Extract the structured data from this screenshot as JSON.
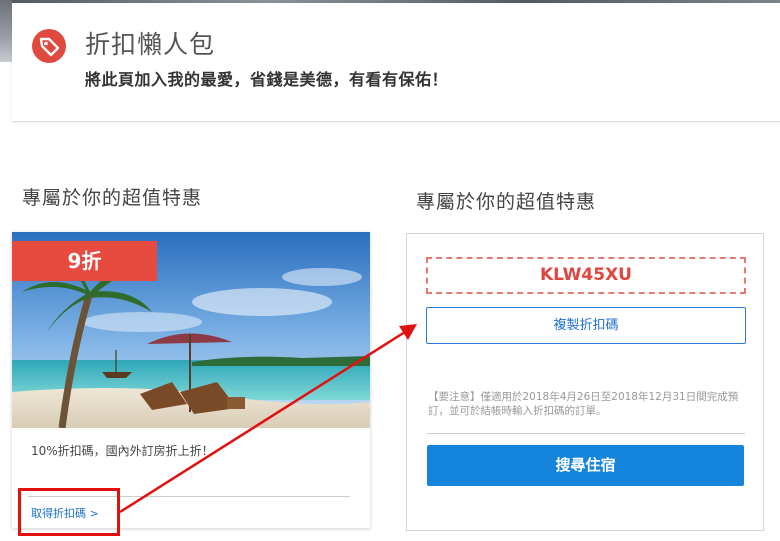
{
  "banner": {
    "icon": "tag-icon",
    "title": "折扣懶人包",
    "subtitle": "將此頁加入我的最愛，省錢是美德，有看有保佑！"
  },
  "left_section": {
    "title": "專屬於你的超值特惠",
    "deal": {
      "badge": "9折",
      "description": "10%折扣碼，國內外訂房折上折！",
      "link": "取得折扣碼 >",
      "image": "tropical-beach-photo"
    }
  },
  "right_section": {
    "title": "專屬於你的超值特惠",
    "coupon_code": "KLW45XU",
    "copy_button": "複製折扣碼",
    "notice": "【要注意】僅適用於2018年4月26日至2018年12月31日間完成預訂，並可於結帳時輸入折扣碼的訂單。",
    "search_button": "搜尋住宿"
  },
  "colors": {
    "badge_red": "#e74a3f",
    "accent_blue": "#1584dc",
    "annotation_red": "#e31010"
  }
}
